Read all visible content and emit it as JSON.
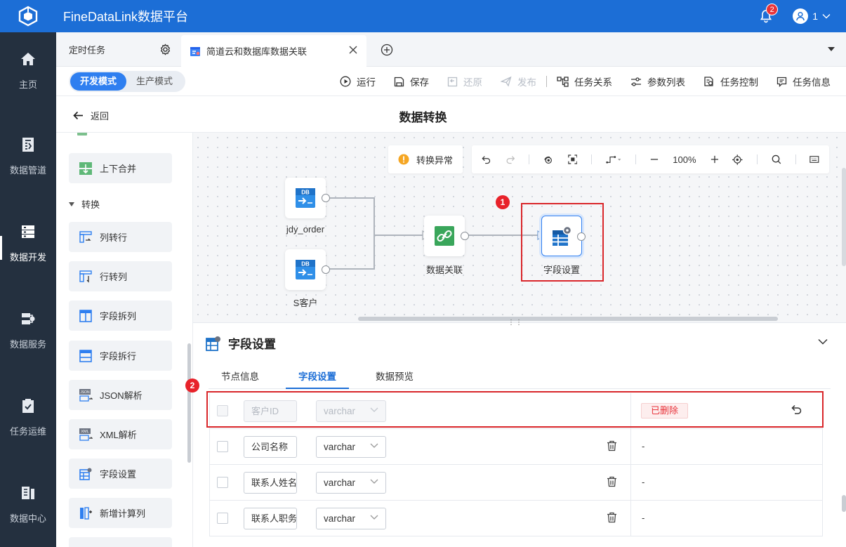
{
  "app": {
    "title": "FineDataLink数据平台",
    "notification_count": "2",
    "user": "1"
  },
  "nav": {
    "items": [
      {
        "label": "主页",
        "icon": "home-icon"
      },
      {
        "label": "数据管道",
        "icon": "pipeline-icon"
      },
      {
        "label": "数据开发",
        "icon": "dev-icon",
        "active": true
      },
      {
        "label": "数据服务",
        "icon": "service-icon"
      },
      {
        "label": "任务运维",
        "icon": "ops-icon"
      },
      {
        "label": "数据中心",
        "icon": "center-icon"
      }
    ]
  },
  "tabs": {
    "items": [
      {
        "label": "定时任务"
      },
      {
        "label": "简道云和数据库数据关联",
        "active": true
      }
    ]
  },
  "toolbar": {
    "modes": [
      "开发模式",
      "生产模式"
    ],
    "actions": [
      {
        "label": "运行",
        "icon": "play-icon"
      },
      {
        "label": "保存",
        "icon": "save-icon"
      },
      {
        "label": "还原",
        "icon": "restore-icon",
        "disabled": true
      },
      {
        "label": "发布",
        "icon": "publish-icon",
        "disabled": true
      },
      {
        "label": "任务关系",
        "icon": "relation-icon"
      },
      {
        "label": "参数列表",
        "icon": "params-icon"
      },
      {
        "label": "任务控制",
        "icon": "control-icon"
      },
      {
        "label": "任务信息",
        "icon": "info-icon"
      }
    ]
  },
  "header": {
    "back_label": "返回",
    "title": "数据转换"
  },
  "operators": {
    "items": [
      {
        "label": "上下合并",
        "icon": "merge-vertical-icon"
      },
      {
        "label": "列转行",
        "icon": "column-to-row-icon"
      },
      {
        "label": "行转列",
        "icon": "row-to-column-icon"
      },
      {
        "label": "字段拆列",
        "icon": "split-column-icon"
      },
      {
        "label": "字段拆行",
        "icon": "split-row-icon"
      },
      {
        "label": "JSON解析",
        "icon": "json-icon"
      },
      {
        "label": "XML解析",
        "icon": "xml-icon"
      },
      {
        "label": "字段设置",
        "icon": "field-settings-icon"
      },
      {
        "label": "新增计算列",
        "icon": "calc-column-icon"
      }
    ],
    "group_label": "转换"
  },
  "canvas": {
    "status_label": "转换异常",
    "zoom": "100%",
    "nodes": [
      {
        "label": "jdy_order",
        "badge": "DB"
      },
      {
        "label": "S客户",
        "badge": "DB"
      },
      {
        "label": "数据关联"
      },
      {
        "label": "字段设置"
      }
    ],
    "markers": [
      "1",
      "2"
    ]
  },
  "panel": {
    "title": "字段设置",
    "tabs": [
      "节点信息",
      "字段设置",
      "数据预览"
    ],
    "rows": [
      {
        "name": "客户ID",
        "type": "varchar",
        "status": "已删除",
        "deleted": true
      },
      {
        "name": "公司名称",
        "type": "varchar",
        "status": "-"
      },
      {
        "name": "联系人姓名",
        "type": "varchar",
        "status": "-"
      },
      {
        "name": "联系人职务",
        "type": "varchar",
        "status": "-"
      }
    ]
  },
  "colors": {
    "brand": "#1c6ed6",
    "nav_bg": "#24303f",
    "alert": "#e8222a",
    "warning": "#f5a623"
  }
}
